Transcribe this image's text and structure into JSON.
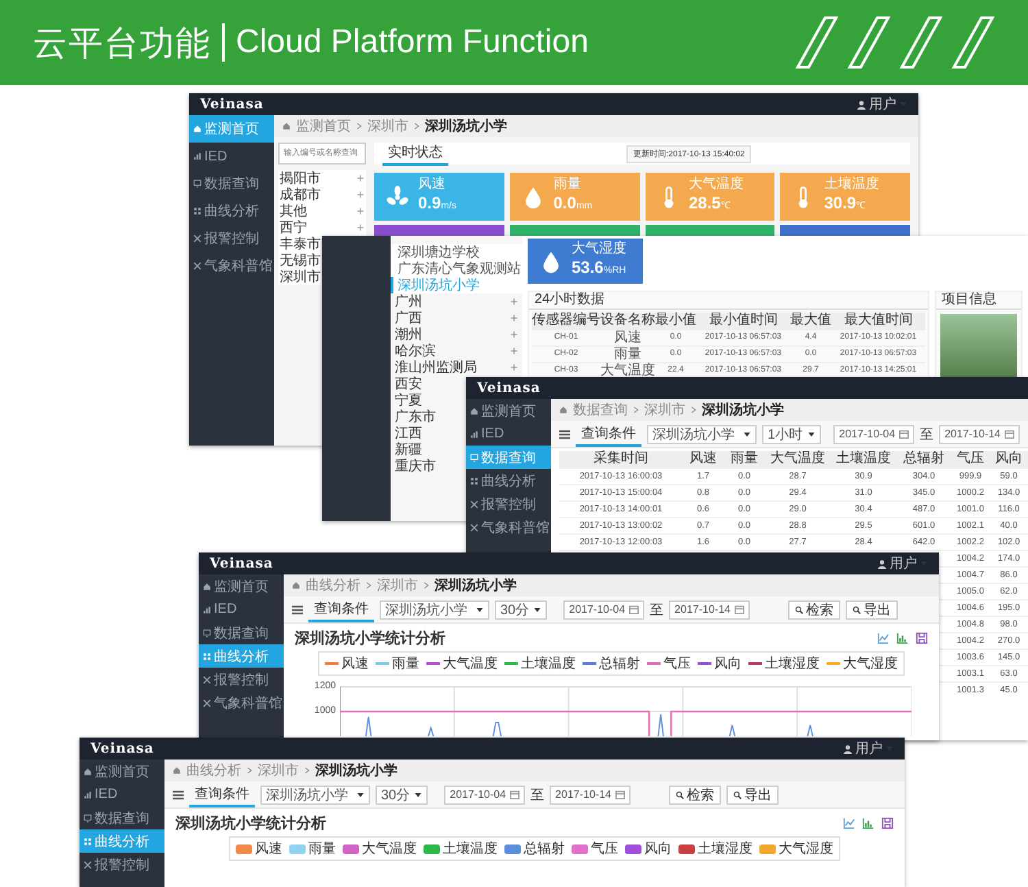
{
  "banner": {
    "title_cn": "云平台功能",
    "title_en": "Cloud Platform Function"
  },
  "windows": [
    {
      "kind": "dashboard",
      "logo": "Veinasa",
      "user": "用户",
      "sidebar": [
        {
          "label": "监测首页",
          "selected": true
        },
        {
          "label": "IED",
          "selected": false
        },
        {
          "label": "数据查询",
          "selected": false
        },
        {
          "label": "曲线分析",
          "selected": false
        },
        {
          "label": "报警控制",
          "selected": false
        },
        {
          "label": "气象科普馆",
          "selected": false
        }
      ],
      "breadcrumb": [
        "监测首页",
        "深圳市",
        "深圳汤坑小学"
      ],
      "search": {
        "placeholder": "输入编号或名称查询"
      },
      "tab": "实时状态",
      "updated": "更新时间:2017-10-13 15:40:02",
      "cities": [
        {
          "kind": "group",
          "label": "揭阳市"
        },
        {
          "kind": "group",
          "label": "成都市"
        },
        {
          "kind": "group",
          "label": "其他"
        },
        {
          "kind": "group",
          "label": "西宁"
        },
        {
          "kind": "city",
          "label": "丰泰市"
        },
        {
          "kind": "city",
          "label": "无锡市"
        },
        {
          "kind": "city",
          "label": "深圳市"
        }
      ],
      "tiles": [
        {
          "label": "风速",
          "value": "0.9",
          "unit": "m/s",
          "color": "#3bb4e6"
        },
        {
          "label": "雨量",
          "value": "0.0",
          "unit": "mm",
          "color": "#f4a94e"
        },
        {
          "label": "大气温度",
          "value": "28.5",
          "unit": "℃",
          "color": "#f4a94e"
        },
        {
          "label": "土壤温度",
          "value": "30.9",
          "unit": "℃",
          "color": "#f4a94e"
        },
        {
          "color": "#8a4fd0"
        },
        {
          "color": "#2fb36b"
        },
        {
          "color": "#2fb36b"
        },
        {
          "color": "#3f6fc8"
        }
      ]
    },
    {
      "kind": "station",
      "sites": [
        {
          "kind": "site",
          "label": "深圳塘边学校",
          "selected": false
        },
        {
          "kind": "site",
          "label": "广东清心气象观测站",
          "selected": false
        },
        {
          "kind": "site",
          "label": "深圳汤坑小学",
          "selected": true
        },
        {
          "kind": "group",
          "label": "广州"
        },
        {
          "kind": "group",
          "label": "广西"
        },
        {
          "kind": "group",
          "label": "潮州"
        },
        {
          "kind": "group",
          "label": "哈尔滨"
        },
        {
          "kind": "group",
          "label": "淮山州监测局"
        },
        {
          "kind": "city",
          "label": "西安"
        },
        {
          "kind": "city",
          "label": "宁夏"
        },
        {
          "kind": "city",
          "label": "广东市"
        },
        {
          "kind": "city",
          "label": "江西"
        },
        {
          "kind": "city",
          "label": "新疆"
        },
        {
          "kind": "city",
          "label": "重庆市"
        }
      ],
      "tile": {
        "label": "大气湿度",
        "value": "53.6",
        "unit": "%RH",
        "color": "#3f7bd0"
      },
      "table_title": "24小时数据",
      "columns": [
        "传感器编号",
        "设备名称",
        "最小值",
        "最小值时间",
        "最大值",
        "最大值时间"
      ],
      "rows": [
        [
          "CH-01",
          "风速",
          "0.0",
          "2017-10-13 06:57:03",
          "4.4",
          "2017-10-13 10:02:01"
        ],
        [
          "CH-02",
          "雨量",
          "0.0",
          "2017-10-13 06:57:03",
          "0.0",
          "2017-10-13 06:57:03"
        ],
        [
          "CH-03",
          "大气温度",
          "22.4",
          "2017-10-13 06:57:03",
          "29.7",
          "2017-10-13 14:25:01"
        ]
      ],
      "info_title": "项目信息"
    },
    {
      "kind": "query",
      "logo": "Veinasa",
      "sidebar": [
        {
          "label": "监测首页",
          "selected": false
        },
        {
          "label": "IED",
          "selected": false
        },
        {
          "label": "数据查询",
          "selected": true
        },
        {
          "label": "曲线分析",
          "selected": false
        },
        {
          "label": "报警控制",
          "selected": false
        },
        {
          "label": "气象科普馆",
          "selected": false
        }
      ],
      "breadcrumb": [
        "数据查询",
        "深圳市",
        "深圳汤坑小学"
      ],
      "filter": {
        "tab": "查询条件",
        "station": "深圳汤坑小学",
        "interval": "1小时",
        "from": "2017-10-04",
        "joiner": "至",
        "to": "2017-10-14"
      },
      "columns": [
        "采集时间",
        "风速",
        "雨量",
        "大气温度",
        "土壤温度",
        "总辐射",
        "气压",
        "风向"
      ],
      "rows": [
        [
          "2017-10-13 16:00:03",
          "1.7",
          "0.0",
          "28.7",
          "30.9",
          "304.0",
          "999.9",
          "59.0"
        ],
        [
          "2017-10-13 15:00:04",
          "0.8",
          "0.0",
          "29.4",
          "31.0",
          "345.0",
          "1000.2",
          "134.0"
        ],
        [
          "2017-10-13 14:00:01",
          "0.6",
          "0.0",
          "29.0",
          "30.4",
          "487.0",
          "1001.0",
          "116.0"
        ],
        [
          "2017-10-13 13:00:02",
          "0.7",
          "0.0",
          "28.8",
          "29.5",
          "601.0",
          "1002.1",
          "40.0"
        ],
        [
          "2017-10-13 12:00:03",
          "1.6",
          "0.0",
          "27.7",
          "28.4",
          "642.0",
          "1002.2",
          "102.0"
        ],
        [
          "1004.2",
          "174.0"
        ],
        [
          "1004.7",
          "86.0"
        ],
        [
          "1005.0",
          "62.0"
        ],
        [
          "1004.6",
          "195.0"
        ],
        [
          "1004.8",
          "98.0"
        ],
        [
          "1004.2",
          "270.0"
        ],
        [
          "1003.6",
          "145.0"
        ],
        [
          "1003.1",
          "63.0"
        ],
        [
          "1001.3",
          "45.0"
        ]
      ]
    },
    {
      "kind": "chart",
      "logo": "Veinasa",
      "user": "用户",
      "sidebar": [
        {
          "label": "监测首页",
          "selected": false
        },
        {
          "label": "IED",
          "selected": false
        },
        {
          "label": "数据查询",
          "selected": false
        },
        {
          "label": "曲线分析",
          "selected": true
        },
        {
          "label": "报警控制",
          "selected": false
        },
        {
          "label": "气象科普馆",
          "selected": false
        }
      ],
      "breadcrumb": [
        "曲线分析",
        "深圳市",
        "深圳汤坑小学"
      ],
      "filter": {
        "tab": "查询条件",
        "station": "深圳汤坑小学",
        "interval": "30分",
        "from": "2017-10-04",
        "joiner": "至",
        "to": "2017-10-14"
      },
      "buttons": [
        "检索",
        "导出"
      ],
      "title": "深圳汤坑小学统计分析",
      "legend": [
        {
          "kind": "line",
          "label": "风速",
          "color": "#f07c3a"
        },
        {
          "kind": "line",
          "label": "雨量",
          "color": "#7ec8e8"
        },
        {
          "kind": "line",
          "label": "大气温度",
          "color": "#b050c8"
        },
        {
          "kind": "line",
          "label": "土壤温度",
          "color": "#2db84a"
        },
        {
          "kind": "line",
          "label": "总辐射",
          "color": "#5b7fdc"
        },
        {
          "kind": "line",
          "label": "气压",
          "color": "#e070b8"
        },
        {
          "kind": "line",
          "label": "风向",
          "color": "#9050d8"
        },
        {
          "kind": "line",
          "label": "土壤湿度",
          "color": "#b83c5c"
        },
        {
          "kind": "line",
          "label": "大气湿度",
          "color": "#f0b020"
        }
      ],
      "y_tick_labels": [
        "1200",
        "1000"
      ]
    },
    {
      "kind": "chart",
      "logo": "Veinasa",
      "user": "用户",
      "sidebar": [
        {
          "label": "监测首页",
          "selected": false
        },
        {
          "label": "IED",
          "selected": false
        },
        {
          "label": "数据查询",
          "selected": false
        },
        {
          "label": "曲线分析",
          "selected": true
        },
        {
          "label": "报警控制",
          "selected": false
        }
      ],
      "breadcrumb": [
        "曲线分析",
        "深圳市",
        "深圳汤坑小学"
      ],
      "filter": {
        "tab": "查询条件",
        "station": "深圳汤坑小学",
        "interval": "30分",
        "from": "2017-10-04",
        "joiner": "至",
        "to": "2017-10-14"
      },
      "buttons": [
        "检索",
        "导出"
      ],
      "title": "深圳汤坑小学统计分析",
      "legend": [
        {
          "kind": "swatch",
          "label": "风速",
          "color": "#f08a4b"
        },
        {
          "kind": "swatch",
          "label": "雨量",
          "color": "#8fd3f0"
        },
        {
          "kind": "swatch",
          "label": "大气温度",
          "color": "#d264c8"
        },
        {
          "kind": "swatch",
          "label": "土壤温度",
          "color": "#2db84a"
        },
        {
          "kind": "swatch",
          "label": "总辐射",
          "color": "#5b8fdc"
        },
        {
          "kind": "swatch",
          "label": "气压",
          "color": "#e070c8"
        },
        {
          "kind": "swatch",
          "label": "风向",
          "color": "#a04fd8"
        },
        {
          "kind": "swatch",
          "label": "土壤湿度",
          "color": "#c84040"
        },
        {
          "kind": "swatch",
          "label": "大气湿度",
          "color": "#f0a830"
        }
      ]
    }
  ]
}
